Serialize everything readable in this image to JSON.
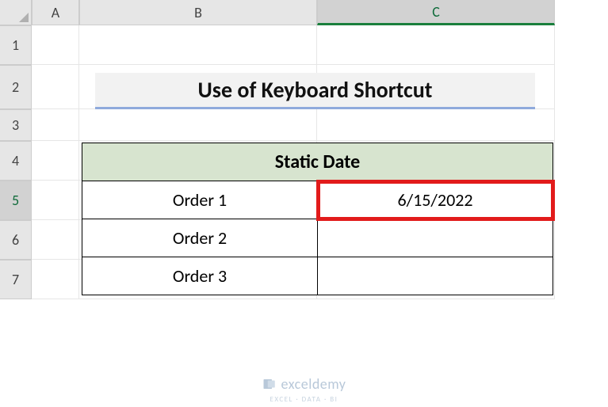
{
  "columns": {
    "A": "A",
    "B": "B",
    "C": "C"
  },
  "rows": {
    "r1": "1",
    "r2": "2",
    "r3": "3",
    "r4": "4",
    "r5": "5",
    "r6": "6",
    "r7": "7"
  },
  "title": "Use of Keyboard Shortcut",
  "table": {
    "header": "Static Date",
    "rows": [
      {
        "label": "Order 1",
        "value": "6/15/2022"
      },
      {
        "label": "Order 2",
        "value": ""
      },
      {
        "label": "Order 3",
        "value": ""
      }
    ]
  },
  "active_cell": "C5",
  "watermark": {
    "text": "exceldemy",
    "sub": "EXCEL · DATA · BI"
  },
  "chart_data": {
    "type": "table",
    "title": "Static Date",
    "categories": [
      "Order 1",
      "Order 2",
      "Order 3"
    ],
    "values": [
      "6/15/2022",
      "",
      ""
    ]
  }
}
